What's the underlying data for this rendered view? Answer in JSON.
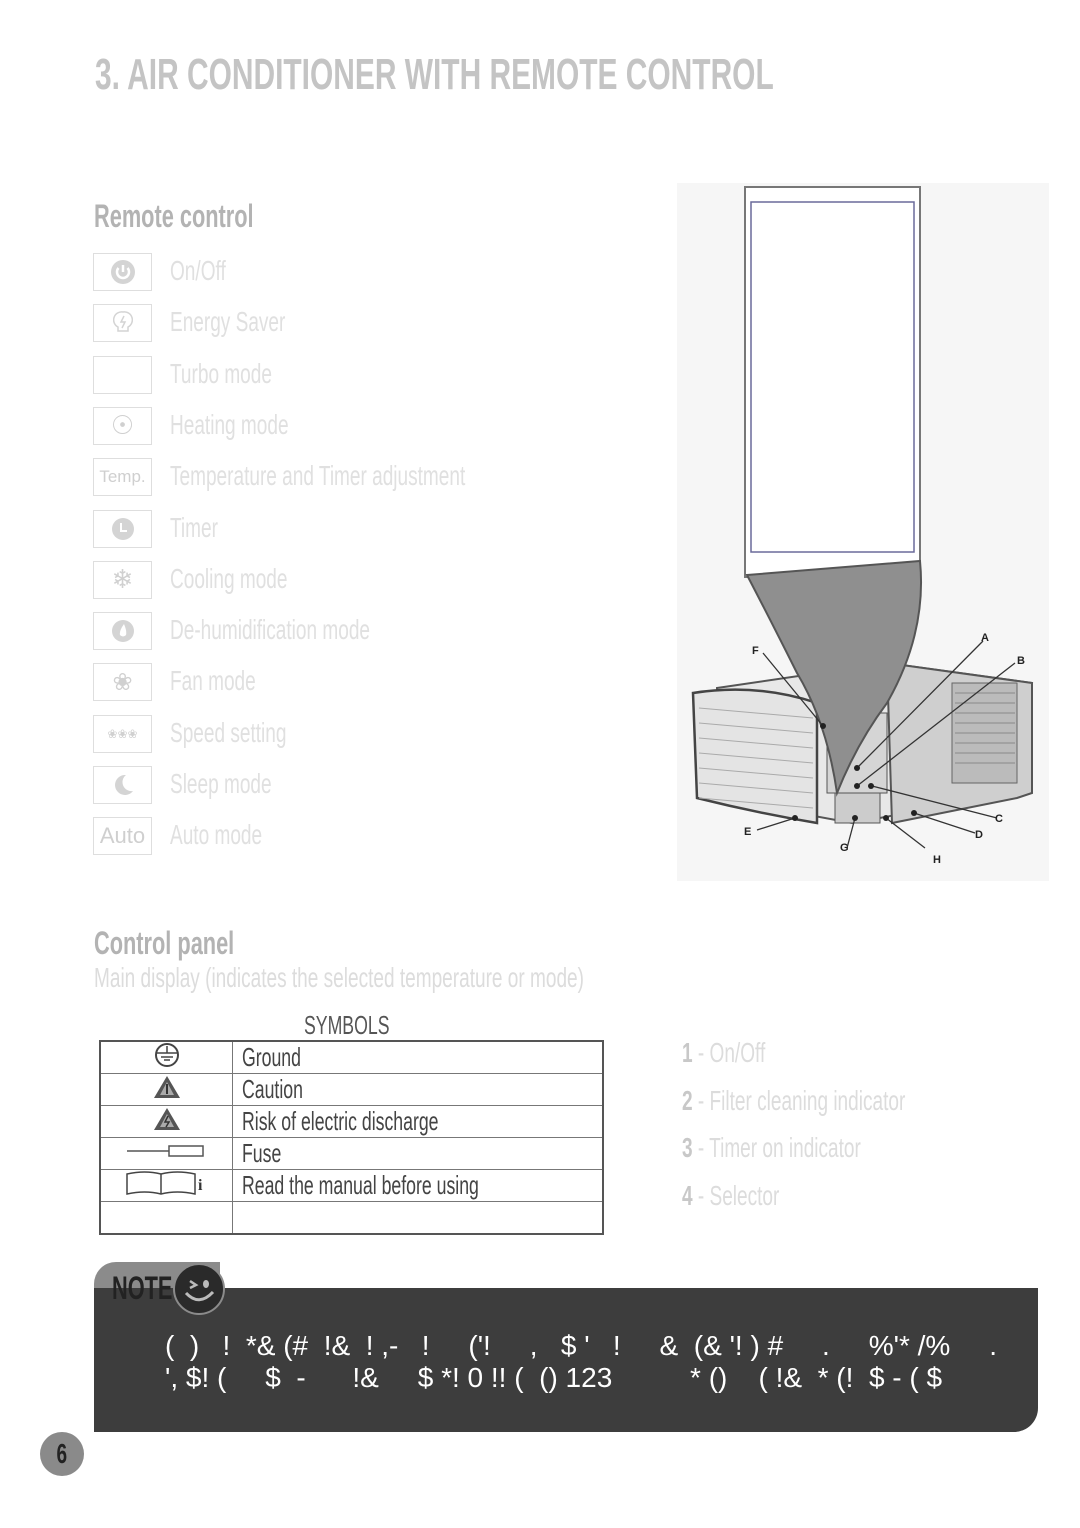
{
  "title": "3. AIR CONDITIONER WITH REMOTE CONTROL",
  "remote_control": {
    "heading": "Remote control",
    "items": [
      {
        "icon": "power-icon",
        "label": "On/Off"
      },
      {
        "icon": "energy-saver-bulb-icon",
        "label": "Energy Saver"
      },
      {
        "icon": "blank-icon",
        "label": "Turbo mode"
      },
      {
        "icon": "sun-icon",
        "label": "Heating mode"
      },
      {
        "icon": "temp-icon",
        "icon_text": "Temp.",
        "label": "Temperature and Timer adjustment"
      },
      {
        "icon": "clock-icon",
        "label": "Timer"
      },
      {
        "icon": "snowflake-icon",
        "label": "Cooling mode"
      },
      {
        "icon": "drop-icon",
        "label": "De-humidification mode"
      },
      {
        "icon": "fan-icon",
        "label": "Fan mode"
      },
      {
        "icon": "speed-fans-icon",
        "label": "Speed setting"
      },
      {
        "icon": "moon-icon",
        "label": "Sleep mode"
      },
      {
        "icon": "auto-icon",
        "icon_text": "Auto",
        "label": "Auto mode"
      }
    ]
  },
  "diagram": {
    "labels": [
      "A",
      "B",
      "C",
      "D",
      "E",
      "F",
      "G",
      "H"
    ]
  },
  "control_panel": {
    "heading": "Control panel",
    "subtitle": "Main display (indicates the selected temperature or mode)",
    "items": [
      {
        "num": "1",
        "label": " - On/Off"
      },
      {
        "num": "2",
        "label": " - Filter cleaning indicator"
      },
      {
        "num": "3",
        "label": " - Timer on indicator"
      },
      {
        "num": "4",
        "label": " - Selector"
      }
    ]
  },
  "symbols": {
    "heading": "SYMBOLS",
    "rows": [
      {
        "icon": "ground-icon",
        "label": "Ground"
      },
      {
        "icon": "caution-triangle-icon",
        "label": "Caution"
      },
      {
        "icon": "electric-triangle-icon",
        "label": "Risk of electric discharge"
      },
      {
        "icon": "fuse-icon",
        "label": "Fuse"
      },
      {
        "icon": "manual-book-icon",
        "label": "Read the manual before using"
      },
      {
        "icon": "",
        "label": ""
      }
    ]
  },
  "note": {
    "label": "NOTE",
    "lines": [
      "(  )   !  *& (#  !&  ! ,-   !     ('!     ,   $ '   !     &  (& '! ) #     .     %'* /%     .",
      "', $! (     $  -      !&     $ *! 0 !! (  () 123          * ()    ( !&  * (!  $ - ( $"
    ]
  },
  "page_number": "6"
}
